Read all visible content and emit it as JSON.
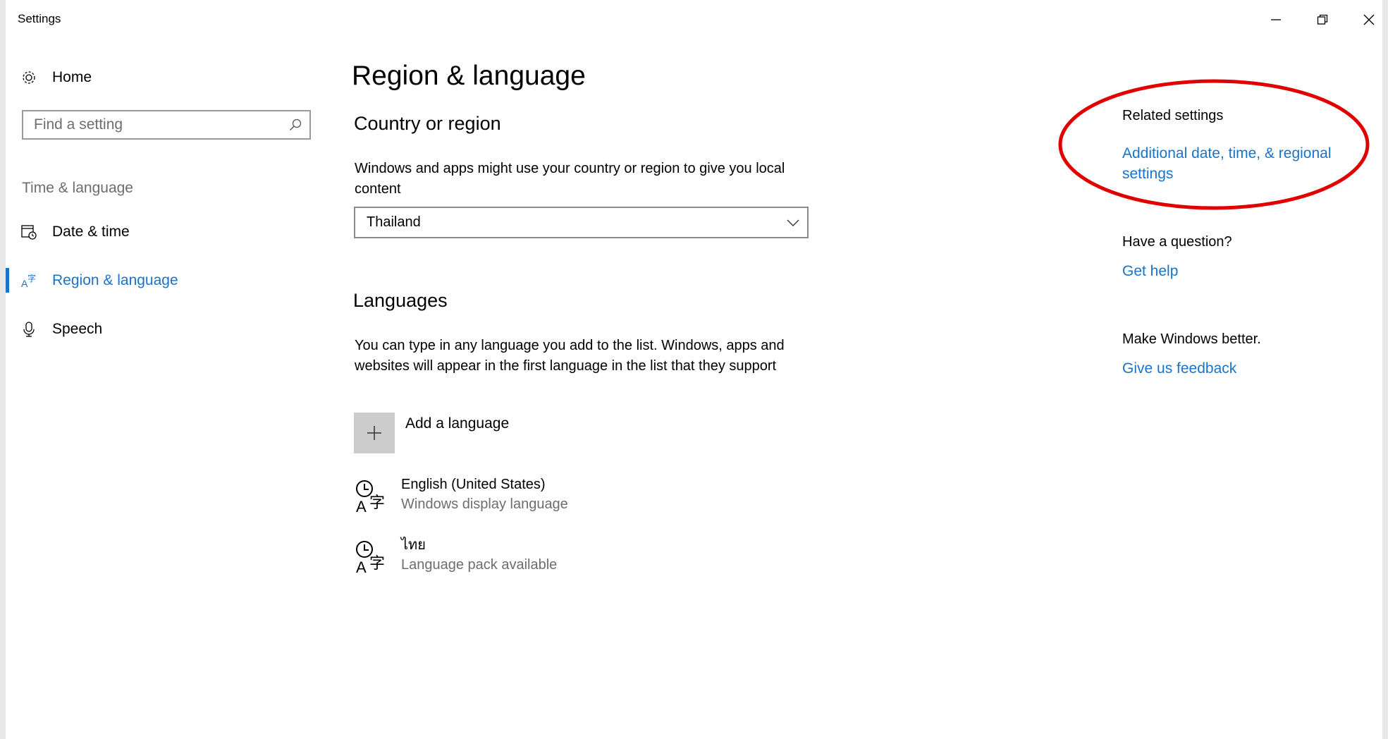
{
  "window": {
    "title": "Settings",
    "controls": [
      "minimize",
      "restore",
      "close"
    ]
  },
  "sidebar": {
    "home_label": "Home",
    "search_placeholder": "Find a setting",
    "section_label": "Time & language",
    "items": [
      {
        "label": "Date & time",
        "icon": "calendar-clock-icon",
        "active": false
      },
      {
        "label": "Region & language",
        "icon": "language-icon",
        "active": true
      },
      {
        "label": "Speech",
        "icon": "microphone-icon",
        "active": false
      }
    ]
  },
  "main": {
    "title": "Region & language",
    "country": {
      "heading": "Country or region",
      "description": "Windows and apps might use your country or region to give you local content",
      "selected": "Thailand"
    },
    "languages": {
      "heading": "Languages",
      "description": "You can type in any language you add to the list. Windows, apps and websites will appear in the first language in the list that they support",
      "add_label": "Add a language",
      "items": [
        {
          "name": "English (United States)",
          "status": "Windows display language"
        },
        {
          "name": "ไทย",
          "status": "Language pack available"
        }
      ]
    }
  },
  "related": {
    "heading": "Related settings",
    "link": "Additional date, time, & regional settings",
    "question_heading": "Have a question?",
    "help_link": "Get help",
    "feedback_heading": "Make Windows better.",
    "feedback_link": "Give us feedback"
  },
  "colors": {
    "accent": "#1a73c8",
    "annotation": "#e00000",
    "secondary_text": "#6d6d6d"
  }
}
